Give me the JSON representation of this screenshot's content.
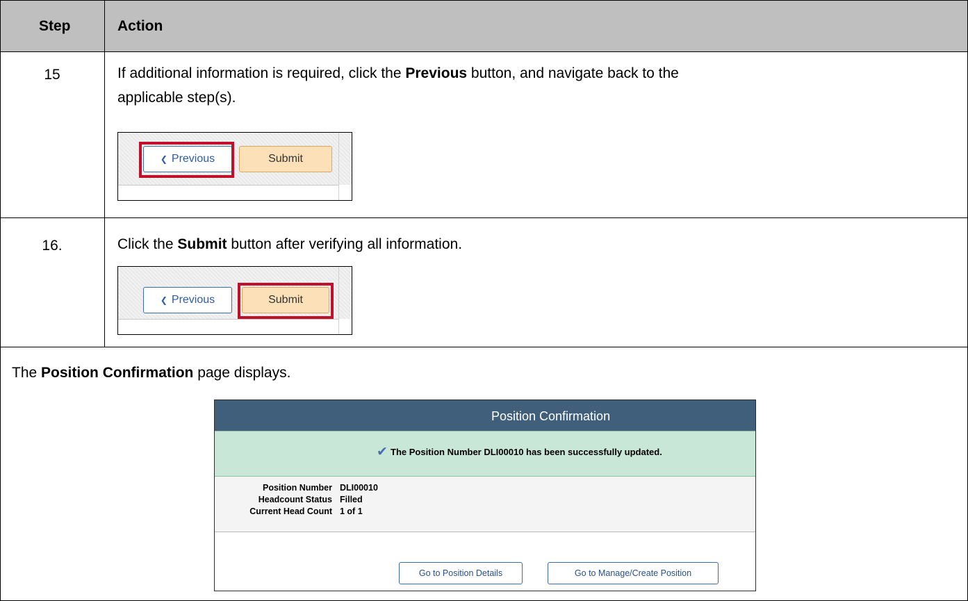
{
  "table": {
    "header": {
      "step": "Step",
      "action": "Action"
    },
    "rows": [
      {
        "step": "15",
        "text_before": "If additional information is required, click the ",
        "bold": "Previous",
        "text_after": " button, and navigate back to the",
        "text_line2": "applicable step(s)."
      },
      {
        "step": "16.",
        "text_before": "Click the ",
        "bold": "Submit",
        "text_after": " button after verifying all information."
      }
    ],
    "footer": {
      "text_before": "The ",
      "bold": "Position Confirmation",
      "text_after": " page displays."
    }
  },
  "buttons": {
    "previous": "Previous",
    "submit": "Submit",
    "previous_icon": "chevron-left-icon",
    "previous_glyph": "❮"
  },
  "confirmation": {
    "title": "Position Confirmation",
    "message": "The Position Number DLI00010 has been successfully updated.",
    "check_glyph": "✔",
    "fields": [
      {
        "label": "Position Number",
        "value": "DLI00010"
      },
      {
        "label": "Headcount Status",
        "value": "Filled"
      },
      {
        "label": "Current Head Count",
        "value": "1 of 1"
      }
    ],
    "actions": {
      "details": "Go to Position Details",
      "manage": "Go to Manage/Create Position"
    }
  },
  "colors": {
    "header_bg": "#bfbfbf",
    "highlight": "#c0102a",
    "panel_title": "#3f5f7a",
    "success_bg": "#c9e7d6"
  }
}
